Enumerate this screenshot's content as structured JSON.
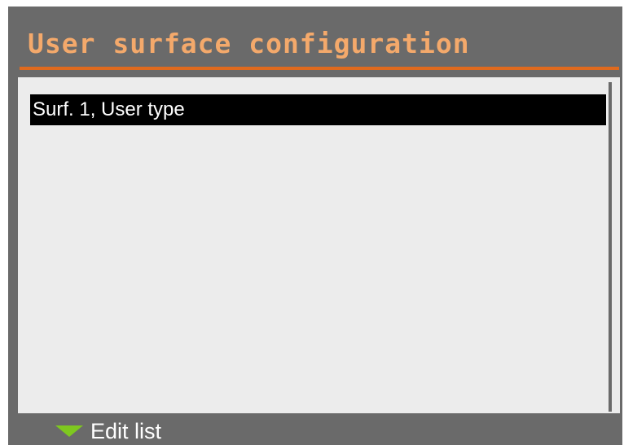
{
  "window": {
    "title": "User surface configuration"
  },
  "list": {
    "items": [
      {
        "label": "Surf. 1, User type",
        "selected": true
      }
    ]
  },
  "footer": {
    "action_icon": "triangle-down-icon",
    "action_label": "Edit list"
  },
  "colors": {
    "background": "#6a6a6a",
    "title_text": "#f4a96b",
    "accent_rule": "#e06a1e",
    "panel": "#ececec",
    "selection": "#000000",
    "softkey_icon": "#7ec81f"
  }
}
